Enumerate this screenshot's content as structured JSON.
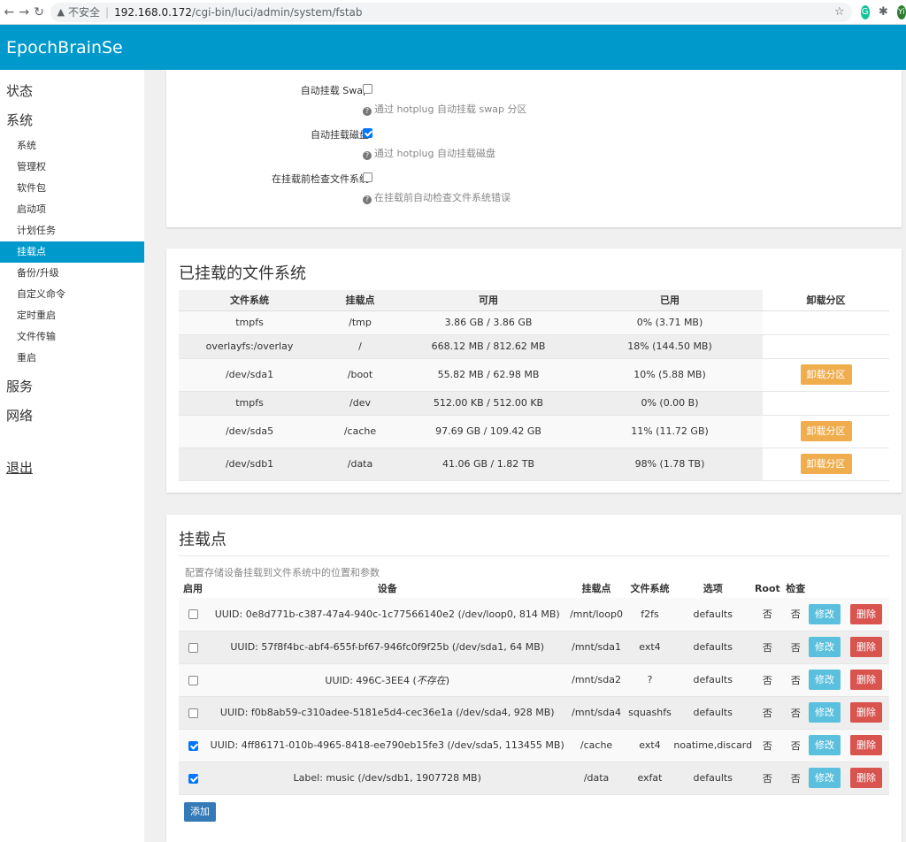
{
  "browser": {
    "back_icon": "←",
    "forward_icon": "→",
    "reload_icon": "↻",
    "warning_icon": "▲",
    "insecure_label": "不安全",
    "host": "192.168.0.172",
    "path": "/cgi-bin/luci/admin/system/fstab",
    "star_icon": "☆",
    "ext1": "G",
    "ext2": "✱",
    "avatar": "Yi"
  },
  "header": {
    "brand": "EpochBrainSe"
  },
  "sidebar": {
    "status": "状态",
    "system": "系统",
    "items": [
      "系统",
      "管理权",
      "软件包",
      "启动项",
      "计划任务",
      "挂载点",
      "备份/升级",
      "自定义命令",
      "定时重启",
      "文件传输",
      "重启"
    ],
    "active_index": 5,
    "services": "服务",
    "network": "网络",
    "logout": "退出"
  },
  "options": {
    "auto_swap_label": "自动挂载 Swap",
    "auto_swap_checked": false,
    "auto_swap_hint": "通过 hotplug 自动挂载 swap 分区",
    "auto_mount_label": "自动挂载磁盘",
    "auto_mount_checked": true,
    "auto_mount_hint": "通过 hotplug 自动挂载磁盘",
    "check_fs_label": "在挂载前检查文件系统",
    "check_fs_checked": false,
    "check_fs_hint": "在挂载前自动检查文件系统错误"
  },
  "mounted": {
    "title": "已挂载的文件系统",
    "headers": [
      "文件系统",
      "挂载点",
      "可用",
      "已用",
      "卸载分区"
    ],
    "unmount_label": "卸载分区",
    "rows": [
      {
        "fs": "tmpfs",
        "mount": "/tmp",
        "avail": "3.86 GB / 3.86 GB",
        "used": "0% (3.71 MB)",
        "unmount": false
      },
      {
        "fs": "overlayfs:/overlay",
        "mount": "/",
        "avail": "668.12 MB / 812.62 MB",
        "used": "18% (144.50 MB)",
        "unmount": false
      },
      {
        "fs": "/dev/sda1",
        "mount": "/boot",
        "avail": "55.82 MB / 62.98 MB",
        "used": "10% (5.88 MB)",
        "unmount": true
      },
      {
        "fs": "tmpfs",
        "mount": "/dev",
        "avail": "512.00 KB / 512.00 KB",
        "used": "0% (0.00 B)",
        "unmount": false
      },
      {
        "fs": "/dev/sda5",
        "mount": "/cache",
        "avail": "97.69 GB / 109.42 GB",
        "used": "11% (11.72 GB)",
        "unmount": true
      },
      {
        "fs": "/dev/sdb1",
        "mount": "/data",
        "avail": "41.06 GB / 1.82 TB",
        "used": "98% (1.78 TB)",
        "unmount": true
      }
    ]
  },
  "mountpoints": {
    "title": "挂载点",
    "description": "配置存储设备挂载到文件系统中的位置和参数",
    "headers": [
      "启用",
      "设备",
      "挂载点",
      "文件系统",
      "选项",
      "Root",
      "检查"
    ],
    "edit_label": "修改",
    "delete_label": "删除",
    "add_label": "添加",
    "rows": [
      {
        "enabled": false,
        "device": "UUID: 0e8d771b-c387-47a4-940c-1c77566140e2 (/dev/loop0, 814 MB)",
        "device_note": "",
        "mount": "/mnt/loop0",
        "fs": "f2fs",
        "opts": "defaults",
        "root": "否",
        "check": "否"
      },
      {
        "enabled": false,
        "device": "UUID: 57f8f4bc-abf4-655f-bf67-946fc0f9f25b (/dev/sda1, 64 MB)",
        "device_note": "",
        "mount": "/mnt/sda1",
        "fs": "ext4",
        "opts": "defaults",
        "root": "否",
        "check": "否"
      },
      {
        "enabled": false,
        "device": "UUID: 496C-3EE4 (",
        "device_note": "不存在",
        "device_tail": ")",
        "mount": "/mnt/sda2",
        "fs": "?",
        "opts": "defaults",
        "root": "否",
        "check": "否"
      },
      {
        "enabled": false,
        "device": "UUID: f0b8ab59-c310adee-5181e5d4-cec36e1a (/dev/sda4, 928 MB)",
        "device_note": "",
        "mount": "/mnt/sda4",
        "fs": "squashfs",
        "opts": "defaults",
        "root": "否",
        "check": "否"
      },
      {
        "enabled": true,
        "device": "UUID: 4ff86171-010b-4965-8418-ee790eb15fe3 (/dev/sda5, 113455 MB)",
        "device_note": "",
        "mount": "/cache",
        "fs": "ext4",
        "opts": "noatime,discard",
        "root": "否",
        "check": "否"
      },
      {
        "enabled": true,
        "device": "Label: music (/dev/sdb1, 1907728 MB)",
        "device_note": "",
        "mount": "/data",
        "fs": "exfat",
        "opts": "defaults",
        "root": "否",
        "check": "否"
      }
    ]
  },
  "colors": {
    "brand": "#0099cc",
    "unmount": "#f0ad4e",
    "edit": "#5bc0de",
    "delete": "#d9534f",
    "add": "#337ab7"
  }
}
